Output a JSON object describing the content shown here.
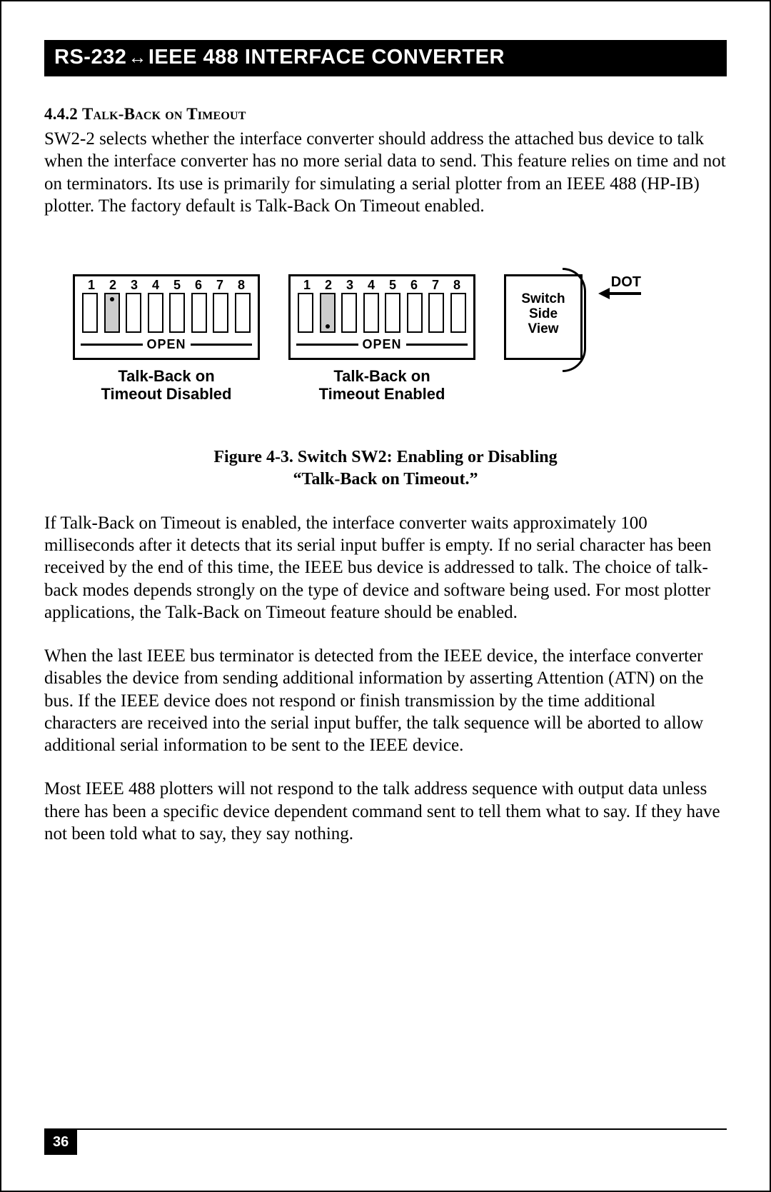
{
  "header": {
    "left": "RS-232",
    "arrow": "↔",
    "right": "IEEE 488 INTERFACE CONVERTER"
  },
  "section": {
    "number": "4.4.2",
    "title": "Talk-Back on Timeout"
  },
  "para1": "SW2-2 selects whether the interface converter should address the attached bus device to talk when the interface converter has no more serial data to send. This feature relies on time and not on terminators. Its use is primarily for simulating a serial plotter from an IEEE 488 (HP-IB) plotter. The factory default is Talk-Back On Timeout enabled.",
  "dip": {
    "numbers": [
      "1",
      "2",
      "3",
      "4",
      "5",
      "6",
      "7",
      "8"
    ],
    "open": "OPEN",
    "left": {
      "caption1": "Talk-Back on",
      "caption2": "Timeout Disabled",
      "active_pos": "top"
    },
    "right": {
      "caption1": "Talk-Back on",
      "caption2": "Timeout Enabled",
      "active_pos": "bot"
    },
    "sideview": {
      "line1": "Switch",
      "line2": "Side",
      "line3": "View",
      "dot": "DOT"
    }
  },
  "figure": {
    "line1": "Figure 4-3. Switch SW2: Enabling or Disabling",
    "line2": "“Talk-Back on Timeout.”"
  },
  "para2": "If Talk-Back on Timeout is enabled, the interface converter waits approximately 100 milliseconds after it detects that its serial input buffer is empty. If no serial character has been received by the end of this time, the IEEE bus device is addressed to talk. The choice of talk-back modes depends strongly on the type of device and software being used. For most plotter applications, the Talk-Back on Timeout feature should be enabled.",
  "para3": "When the last IEEE bus terminator is detected from the IEEE device, the interface converter disables the device from sending additional information by asserting Attention (ATN) on the bus. If the IEEE device does not respond or finish transmission by the time additional characters are received into the serial input buffer, the talk sequence will be aborted to allow additional serial information to be sent to the IEEE device.",
  "para4": "Most IEEE 488 plotters will not respond to the talk address sequence with output data unless there has been a specific device dependent command sent to tell them what to say. If they have not been told what to say, they say nothing.",
  "page_number": "36"
}
